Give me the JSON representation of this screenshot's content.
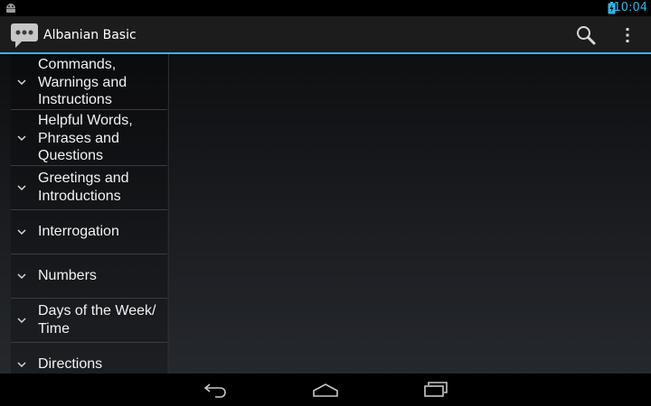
{
  "status_bar": {
    "time": "10:04"
  },
  "action_bar": {
    "title": "Albanian Basic"
  },
  "sidebar": {
    "items": [
      {
        "label": "Commands, Warnings and Instructions"
      },
      {
        "label": "Helpful Words, Phrases and Questions"
      },
      {
        "label": "Greetings and Introductions"
      },
      {
        "label": "Interrogation"
      },
      {
        "label": "Numbers"
      },
      {
        "label": "Days of the Week/ Time"
      },
      {
        "label": "Directions"
      }
    ]
  },
  "colors": {
    "accent": "#33b5e5",
    "action_bar": "#1c1c1c"
  },
  "icons": [
    "android-robot-icon",
    "battery-charging-icon",
    "chat-bubble-app-icon",
    "search-icon",
    "overflow-menu-icon",
    "chevron-down-icon",
    "back-icon",
    "home-icon",
    "recent-apps-icon"
  ]
}
